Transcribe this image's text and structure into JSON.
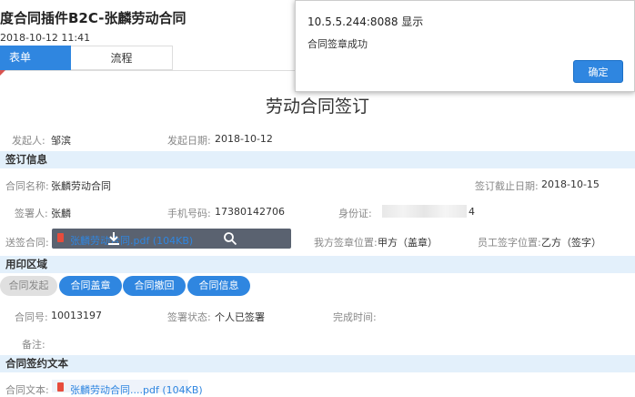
{
  "header": {
    "title": "度合同插件B2C-张麟劳动合同",
    "date": "2018-10-12 11:41"
  },
  "tabs": [
    {
      "label": "表单"
    },
    {
      "label": "流程"
    }
  ],
  "page_heading": "劳动合同签订",
  "meta": {
    "initiator_label": "发起人:",
    "initiator": "邹滨",
    "start_date_label": "发起日期:",
    "start_date": "2018-10-12"
  },
  "sections": {
    "sign_info": "签订信息",
    "seal_area": "用印区域",
    "contract_text": "合同签约文本"
  },
  "sign_info": {
    "contract_name_label": "合同名称:",
    "contract_name": "张麟劳动合同",
    "deadline_label": "签订截止日期:",
    "deadline": "2018-10-15",
    "signer_label": "签署人:",
    "signer": "张麟",
    "phone_label": "手机号码:",
    "phone": "17380142706",
    "id_label": "身份证:",
    "id_tail": "4",
    "send_label": "送签合同:",
    "file": "张麟劳动合同.pdf (104KB)",
    "our_pos_label": "我方签章位置:",
    "our_pos": "甲方（盖章）",
    "emp_pos_label": "员工签字位置:",
    "emp_pos": "乙方（签字）"
  },
  "buttons": {
    "initiate": "合同发起",
    "seal": "合同盖章",
    "revoke": "合同撤回",
    "info": "合同信息"
  },
  "contract": {
    "no_label": "合同号:",
    "no": "10013197",
    "status_label": "签署状态:",
    "status": "个人已签署",
    "done_label": "完成时间:",
    "note_label": "备注:"
  },
  "contract_text": {
    "label": "合同文本:",
    "file": "张麟劳动合同....pdf (104KB)"
  },
  "dialog": {
    "title": "10.5.5.244:8088 显示",
    "message": "合同签章成功",
    "ok": "确定"
  },
  "colors": {
    "accent": "#2f86e0",
    "section_bg": "#e3f0fb"
  }
}
